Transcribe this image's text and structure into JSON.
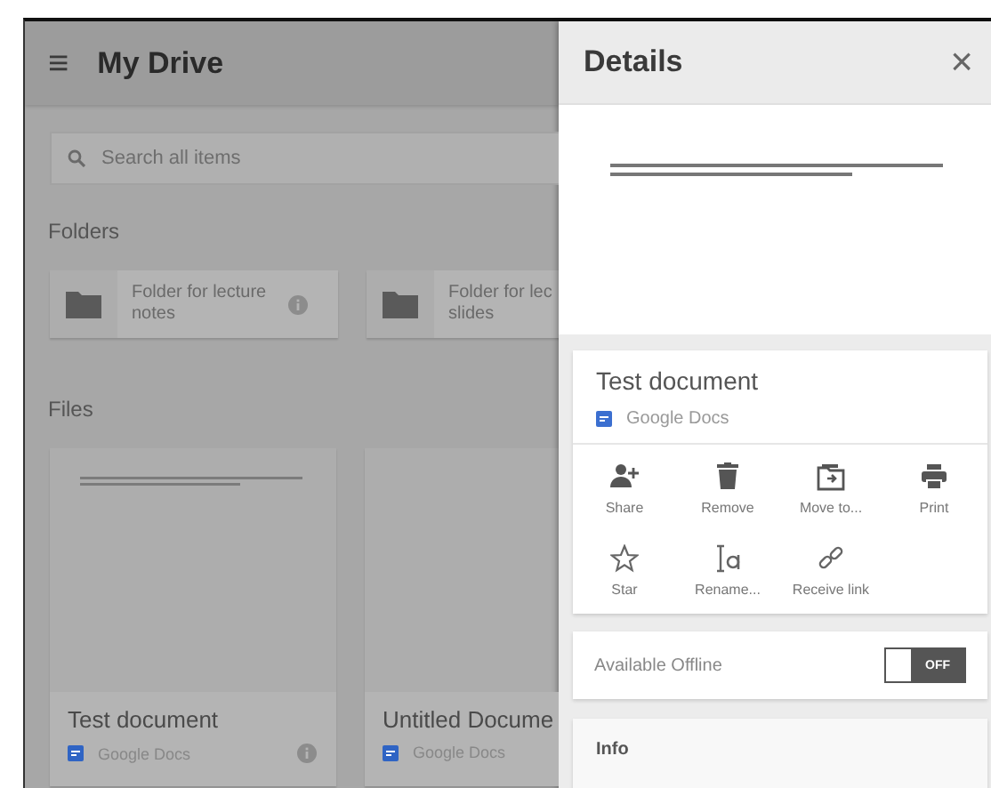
{
  "drive": {
    "menu_icon": "≡",
    "title": "My Drive",
    "search": {
      "placeholder": "Search all items"
    },
    "folders_heading": "Folders",
    "folders": [
      {
        "lines": [
          "Folder for lecture",
          "notes"
        ],
        "info_icon": true
      },
      {
        "lines": [
          "Folder for lec",
          "slides"
        ]
      }
    ],
    "files_heading": "Files",
    "files": [
      {
        "title": "Test document",
        "type": "Google Docs",
        "preview_text": true,
        "info_icon": true
      },
      {
        "title": "Untitled Docume",
        "type": "Google Docs",
        "preview_text": false
      }
    ]
  },
  "details": {
    "title": "Details",
    "close": "×",
    "file_title": "Test document",
    "file_type": "Google Docs",
    "actions": [
      {
        "kind": "share",
        "label": "Share"
      },
      {
        "kind": "remove",
        "label": "Remove"
      },
      {
        "kind": "move",
        "label": "Move to..."
      },
      {
        "kind": "print",
        "label": "Print"
      },
      {
        "kind": "star",
        "label": "Star"
      },
      {
        "kind": "rename",
        "label": "Rename..."
      },
      {
        "kind": "link",
        "label": "Receive link"
      }
    ],
    "offline": {
      "label": "Available Offline",
      "on": false,
      "state_text": "OFF"
    },
    "info_heading": "Info"
  }
}
